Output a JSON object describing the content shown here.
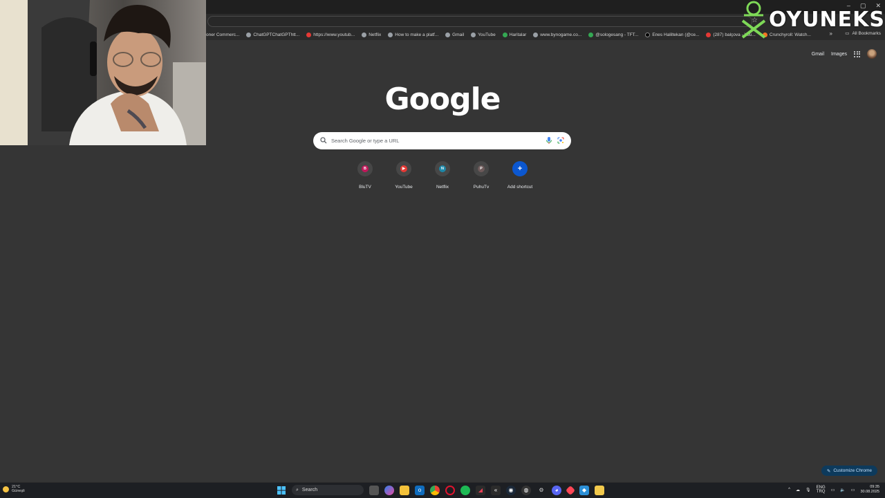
{
  "window": {
    "controls": [
      "–",
      "▢",
      "✕"
    ]
  },
  "bookmarks": [
    {
      "label": "oner Commerc...",
      "icon": "none"
    },
    {
      "label": "ChatGPTChatGPThtt...",
      "icon": "gray"
    },
    {
      "label": "https://www.youtub...",
      "icon": "red"
    },
    {
      "label": "Netflix",
      "icon": "gray"
    },
    {
      "label": "How to make a platf...",
      "icon": "gray"
    },
    {
      "label": "Gmail",
      "icon": "gray"
    },
    {
      "label": "YouTube",
      "icon": "gray"
    },
    {
      "label": "Haritalar",
      "icon": "green"
    },
    {
      "label": "www.bynogame.co...",
      "icon": "gray"
    },
    {
      "label": "@sologesang - TFT...",
      "icon": "green"
    },
    {
      "label": "Enes Haliltekan (@ce...",
      "icon": "dark"
    },
    {
      "label": "(287) balçova - You...",
      "icon": "red"
    },
    {
      "label": "Crunchyroll: Watch...",
      "icon": "orange"
    }
  ],
  "bookmarks_overflow": "»",
  "all_bookmarks": "All Bookmarks",
  "top_links": {
    "gmail": "Gmail",
    "images": "Images"
  },
  "logo": "Google",
  "search": {
    "placeholder": "Search Google or type a URL",
    "value": ""
  },
  "shortcuts": [
    {
      "label": "BluTV",
      "letter": "B",
      "color": "#c2185b"
    },
    {
      "label": "YouTube",
      "letter": "▶",
      "color": "#e53935"
    },
    {
      "label": "Netflix",
      "letter": "N",
      "color": "#1e88a8"
    },
    {
      "label": "PuhuTv",
      "letter": "P",
      "color": "#6d5a5a"
    },
    {
      "label": "Add shortcut",
      "letter": "+",
      "color": "#0b57d0"
    }
  ],
  "customize": "Customize Chrome",
  "brand": "OYUNEKS",
  "taskbar": {
    "search_label": "Search",
    "weather_temp": "21°C",
    "weather_desc": "Güneşli",
    "lang_1": "ENG",
    "lang_2": "TRQ",
    "time": "09:35",
    "date": "30.08.2025"
  }
}
